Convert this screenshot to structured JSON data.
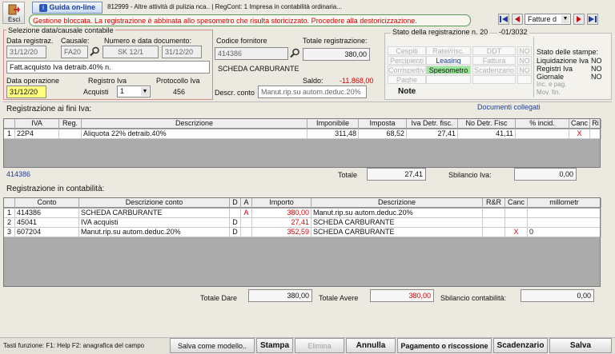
{
  "toolbar": {
    "exit_label": "Esci",
    "guide_label": "Guida on-line",
    "header_text": "812999 - Altre attività di pulizia nca.. | RegCont: 1 Impresa in contabilità ordinaria...",
    "alert_text": "Gestione bloccata. La registrazione è abbinata allo spesometro che risulta storicizzato. Procedere alla destoricizzazione.",
    "nav_select": "Fatture d"
  },
  "selection": {
    "group_title": "Selezione data/causale contabile",
    "date_label": "Data registraz.",
    "date_value": "31/12/20",
    "causal_label": "Causale:",
    "causal_value": "FA20",
    "doc_label": "Numero e data documento:",
    "doc_number": "SK 12/1",
    "doc_date": "31/12/20",
    "causal_description": "Fatt.acquisto Iva detraib.40% n.",
    "op_label": "Data operazione",
    "op_value": "31/12/20",
    "register_label": "Registro Iva",
    "register_type": "Acquisti",
    "register_number": "1",
    "protocol_label": "Protocollo Iva",
    "protocol_value": "456"
  },
  "supplier": {
    "code_label": "Codice fornitore",
    "code_value": "414386",
    "total_label": "Totale registrazione:",
    "total_value": "380,00",
    "name": "SCHEDA CARBURANTE",
    "balance_label": "Saldo:",
    "balance_value": "-11.868,00",
    "account_desc_label": "Descr. conto",
    "account_desc_value": "Manut.rip.su autom.deduc.20%"
  },
  "status": {
    "title": "Stato della registrazione n. 20",
    "ref": "-01/3032",
    "rows": [
      [
        "Cespiti",
        "Ratei/risc.",
        "DDT",
        "NO"
      ],
      [
        "Percipienti",
        "Leasing",
        "Fattura",
        "NO"
      ],
      [
        "Corrispettivi",
        "Spesometro",
        "Scadenzario",
        "NO"
      ],
      [
        "Paghe",
        "",
        "",
        ""
      ]
    ],
    "note_label": "Note",
    "print_title": "Stato delle stampe:",
    "prints": [
      [
        "Liquidazione Iva",
        "NO"
      ],
      [
        "Registri Iva",
        "NO"
      ],
      [
        "Giornale",
        "NO"
      ],
      [
        "Inc. e pag.",
        ""
      ],
      [
        "Mov. fin.",
        ""
      ]
    ]
  },
  "vat": {
    "section_label": "Registrazione ai fini Iva:",
    "linked_docs": "Documenti collegati",
    "headers": [
      "",
      "IVA",
      "Reg.",
      "Descrizione",
      "Imponibile",
      "Imposta",
      "Iva Detr. fisc.",
      "No Detr. Fisc",
      "% incid.",
      "Canc",
      "Ri"
    ],
    "rows": [
      [
        "1",
        "22P4",
        "",
        "Aliquota 22% detraib.40%",
        "311,48",
        "68,52",
        "27,41",
        "41,11",
        "",
        "X",
        ""
      ]
    ],
    "account_code": "414386",
    "total_label": "Totale",
    "total_value": "27,41",
    "imbalance_label": "Sbilancio Iva:",
    "imbalance_value": "0,00"
  },
  "accounting": {
    "section_label": "Registrazione in contabilità:",
    "headers": [
      "",
      "Conto",
      "Descrizione conto",
      "D",
      "A",
      "Importo",
      "Descrizione",
      "R&R",
      "Canc",
      "millometr"
    ],
    "rows": [
      [
        "1",
        "414386",
        "SCHEDA CARBURANTE",
        "",
        "A",
        "380,00",
        "Manut.rip.su autom.deduc.20%",
        "",
        "",
        ""
      ],
      [
        "2",
        "45041",
        "IVA acquisti",
        "D",
        "",
        "27,41",
        "SCHEDA CARBURANTE",
        "",
        "",
        ""
      ],
      [
        "3",
        "607204",
        "Manut.rip.su autom.deduc.20%",
        "D",
        "",
        "352,59",
        "SCHEDA CARBURANTE",
        "",
        "X",
        "0"
      ]
    ],
    "total_dare_label": "Totale Dare",
    "total_dare_value": "380,00",
    "total_avere_label": "Totale Avere",
    "total_avere_value": "380,00",
    "imbalance_label": "Sbilancio contabilità:",
    "imbalance_value": "0,00"
  },
  "footer": {
    "keys_text": "Tasti funzione:  F1: Help  F2: anagrafica del campo",
    "save_model": "Salva come modello..",
    "print": "Stampa",
    "delete": "Elimina",
    "cancel": "Annulla",
    "payment": "Pagamento o riscossione",
    "schedule": "Scadenzario",
    "save": "Salva"
  },
  "colors": {
    "alert_red": "#d60000",
    "blue_link": "#1a3ea0",
    "highlight_yellow": "#ffff80",
    "spesometro_green": "#9be89b"
  }
}
